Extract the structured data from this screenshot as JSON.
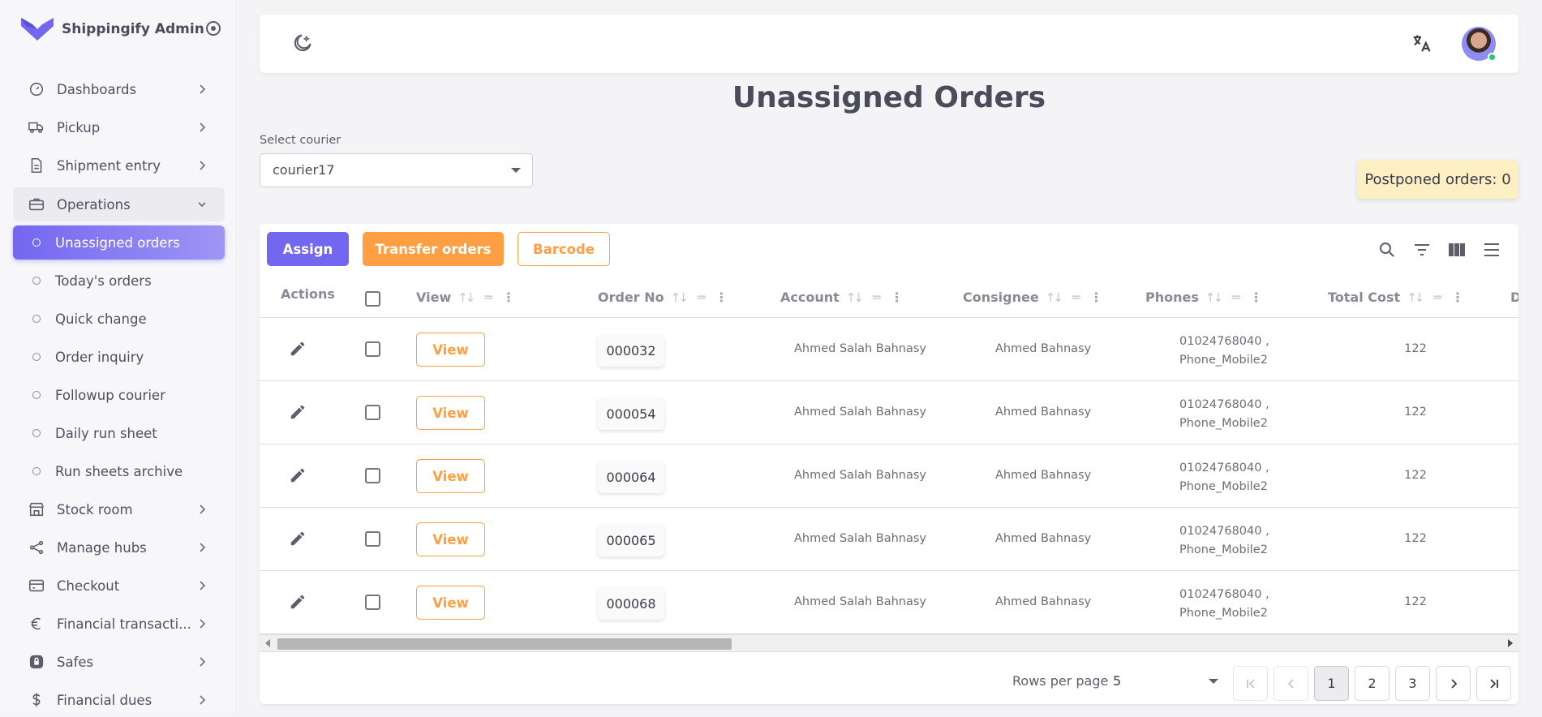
{
  "brand": {
    "name": "Shippingify Admin",
    "logo_icon": "brand-logo-icon",
    "accent": "#7367f0"
  },
  "sidebar": {
    "items": [
      {
        "label": "Dashboards",
        "icon": "gauge-icon",
        "expandable": true
      },
      {
        "label": "Pickup",
        "icon": "truck-icon",
        "expandable": true
      },
      {
        "label": "Shipment entry",
        "icon": "document-icon",
        "expandable": true
      },
      {
        "label": "Operations",
        "icon": "briefcase-icon",
        "expandable": true,
        "open": true
      },
      {
        "label": "Unassigned orders",
        "sub": true,
        "active": true
      },
      {
        "label": "Today's orders",
        "sub": true
      },
      {
        "label": "Quick change",
        "sub": true
      },
      {
        "label": "Order inquiry",
        "sub": true
      },
      {
        "label": "Followup courier",
        "sub": true
      },
      {
        "label": "Daily run sheet",
        "sub": true
      },
      {
        "label": "Run sheets archive",
        "sub": true
      },
      {
        "label": "Stock room",
        "icon": "store-icon",
        "expandable": true
      },
      {
        "label": "Manage hubs",
        "icon": "hub-icon",
        "expandable": true
      },
      {
        "label": "Checkout",
        "icon": "credit-card-icon",
        "expandable": true
      },
      {
        "label": "Financial transacti...",
        "icon": "euro-icon",
        "expandable": true
      },
      {
        "label": "Safes",
        "icon": "lock-icon",
        "expandable": true
      },
      {
        "label": "Financial dues",
        "icon": "dollar-icon",
        "expandable": true
      }
    ]
  },
  "page": {
    "title": "Unassigned Orders"
  },
  "courier_select": {
    "label": "Select courier",
    "value": "courier17"
  },
  "postponed": {
    "text": "Postponed orders: 0"
  },
  "toolbar": {
    "assign_label": "Assign",
    "transfer_label": "Transfer orders",
    "barcode_label": "Barcode"
  },
  "table": {
    "columns": {
      "actions": "Actions",
      "view": "View",
      "order_no": "Order No",
      "account": "Account",
      "consignee": "Consignee",
      "phones": "Phones",
      "total_cost": "Total Cost",
      "cut": "D"
    },
    "rows": [
      {
        "view_label": "View",
        "order_no": "000032",
        "account": "Ahmed Salah Bahnasy",
        "consignee": "Ahmed Bahnasy",
        "phone1": "01024768040 ,",
        "phone2": "Phone_Mobile2",
        "total_cost": "122"
      },
      {
        "view_label": "View",
        "order_no": "000054",
        "account": "Ahmed Salah Bahnasy",
        "consignee": "Ahmed Bahnasy",
        "phone1": "01024768040 ,",
        "phone2": "Phone_Mobile2",
        "total_cost": "122"
      },
      {
        "view_label": "View",
        "order_no": "000064",
        "account": "Ahmed Salah Bahnasy",
        "consignee": "Ahmed Bahnasy",
        "phone1": "01024768040 ,",
        "phone2": "Phone_Mobile2",
        "total_cost": "122"
      },
      {
        "view_label": "View",
        "order_no": "000065",
        "account": "Ahmed Salah Bahnasy",
        "consignee": "Ahmed Bahnasy",
        "phone1": "01024768040 ,",
        "phone2": "Phone_Mobile2",
        "total_cost": "122"
      },
      {
        "view_label": "View",
        "order_no": "000068",
        "account": "Ahmed Salah Bahnasy",
        "consignee": "Ahmed Bahnasy",
        "phone1": "01024768040 ,",
        "phone2": "Phone_Mobile2",
        "total_cost": "122"
      }
    ]
  },
  "pagination": {
    "rows_per_page_label": "Rows per page",
    "rows_per_page": "5",
    "pages": [
      "1",
      "2",
      "3"
    ],
    "current": "1"
  }
}
